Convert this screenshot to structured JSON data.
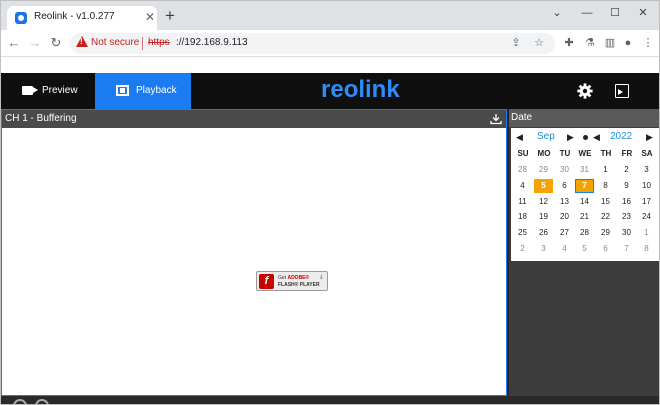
{
  "browser": {
    "tab_title": "Reolink - v1.0.277",
    "tab_close": "✕",
    "new_tab": "+",
    "security_label": "Not secure",
    "url_scheme": "https",
    "url_rest": "://192.168.9.113",
    "window_controls": [
      "⌄",
      "—",
      "☐",
      "✕"
    ]
  },
  "app": {
    "logo": "reolink",
    "nav": [
      {
        "label": "Preview",
        "active": false
      },
      {
        "label": "Playback",
        "active": true
      }
    ],
    "accent_color": "#1a7cf0"
  },
  "player": {
    "channel_status": "CH 1 - Buffering",
    "flash_badge": {
      "line1_prefix": "Get ",
      "line1_brand": "ADOBE®",
      "line2": "FLASH® PLAYER"
    }
  },
  "date_panel": {
    "header": "Date",
    "month": "Sep",
    "year": "2022",
    "weekdays": [
      "SU",
      "MO",
      "TU",
      "WE",
      "TH",
      "FR",
      "SA"
    ],
    "weeks": [
      [
        {
          "d": "28",
          "m": true
        },
        {
          "d": "29",
          "m": true
        },
        {
          "d": "30",
          "m": true
        },
        {
          "d": "31",
          "m": true
        },
        {
          "d": "1"
        },
        {
          "d": "2"
        },
        {
          "d": "3"
        }
      ],
      [
        {
          "d": "4"
        },
        {
          "d": "5",
          "mark": true
        },
        {
          "d": "6"
        },
        {
          "d": "7",
          "today": true
        },
        {
          "d": "8"
        },
        {
          "d": "9"
        },
        {
          "d": "10"
        }
      ],
      [
        {
          "d": "11"
        },
        {
          "d": "12"
        },
        {
          "d": "13"
        },
        {
          "d": "14"
        },
        {
          "d": "15"
        },
        {
          "d": "16"
        },
        {
          "d": "17"
        }
      ],
      [
        {
          "d": "18"
        },
        {
          "d": "19"
        },
        {
          "d": "20"
        },
        {
          "d": "21"
        },
        {
          "d": "22"
        },
        {
          "d": "23"
        },
        {
          "d": "24"
        }
      ],
      [
        {
          "d": "25"
        },
        {
          "d": "26"
        },
        {
          "d": "27"
        },
        {
          "d": "28"
        },
        {
          "d": "29"
        },
        {
          "d": "30"
        },
        {
          "d": "1",
          "m": true
        }
      ],
      [
        {
          "d": "2",
          "m": true
        },
        {
          "d": "3",
          "m": true
        },
        {
          "d": "4",
          "m": true
        },
        {
          "d": "5",
          "m": true
        },
        {
          "d": "6",
          "m": true
        },
        {
          "d": "7",
          "m": true
        },
        {
          "d": "8",
          "m": true
        }
      ]
    ],
    "highlight_color": "#f5a300"
  }
}
